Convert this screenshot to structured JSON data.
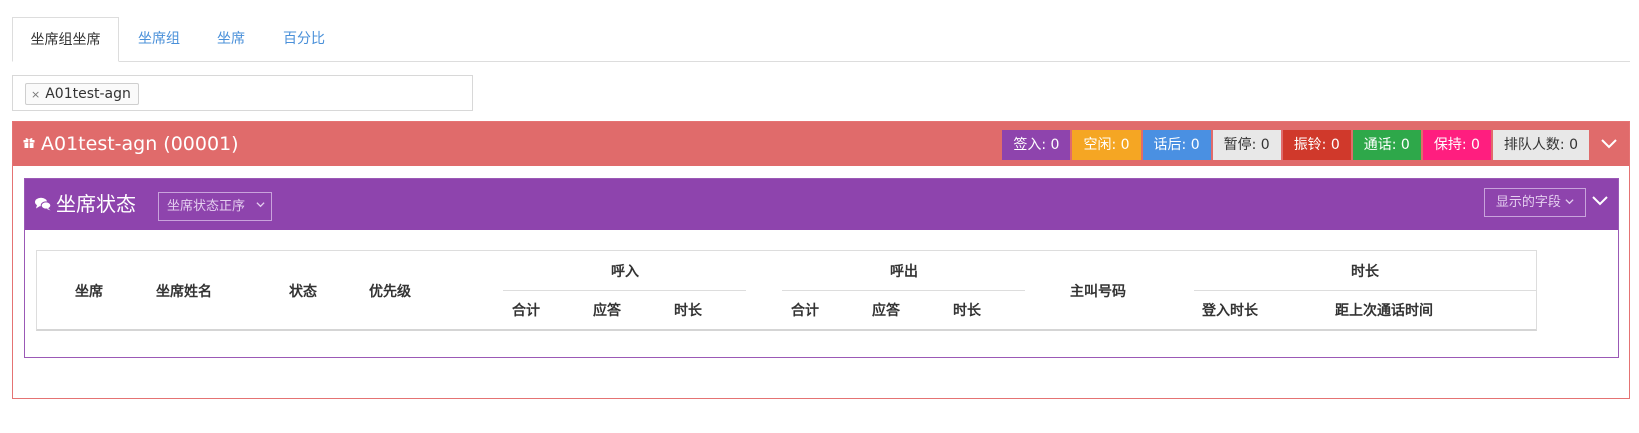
{
  "tabs": [
    {
      "label": "坐席组坐席",
      "active": true
    },
    {
      "label": "坐席组",
      "active": false
    },
    {
      "label": "坐席",
      "active": false
    },
    {
      "label": "百分比",
      "active": false
    }
  ],
  "tag_select": {
    "tags": [
      {
        "label": "A01test-agn",
        "remove_icon": "×"
      }
    ]
  },
  "group_panel": {
    "icon": "gift-icon",
    "title": "A01test-agn  (00001)",
    "badges": [
      {
        "label": "签入: 0",
        "color": "#8e44ad"
      },
      {
        "label": "空闲: 0",
        "color": "#f5a623"
      },
      {
        "label": "话后: 0",
        "color": "#4a90e2"
      },
      {
        "label": "暂停: 0",
        "color": "#e8e8e8"
      },
      {
        "label": "振铃: 0",
        "color": "#d0392b"
      },
      {
        "label": "通话: 0",
        "color": "#2ea84a"
      },
      {
        "label": "保持: 0",
        "color": "#ff1e7f"
      },
      {
        "label": "排队人数: 0",
        "color": "#e8e8e8"
      }
    ],
    "collapse_icon": "chevron-down-icon",
    "header_color": "#e06b6b"
  },
  "agent_panel": {
    "icon": "comments-icon",
    "title": "坐席状态",
    "sort_select": "坐席状态正序",
    "fields_button": "显示的字段",
    "collapse_icon": "chevron-down-icon",
    "header_color": "#8e44ad"
  },
  "table": {
    "headers": {
      "agent": "坐席",
      "agent_name": "坐席姓名",
      "status": "状态",
      "priority": "优先级",
      "inbound": {
        "label": "呼入",
        "sub": [
          "合计",
          "应答",
          "时长"
        ]
      },
      "outbound": {
        "label": "呼出",
        "sub": [
          "合计",
          "应答",
          "时长"
        ]
      },
      "caller_number": "主叫号码",
      "duration": {
        "label": "时长",
        "sub": [
          "登入时长",
          "距上次通话时间"
        ]
      }
    },
    "rows": []
  }
}
